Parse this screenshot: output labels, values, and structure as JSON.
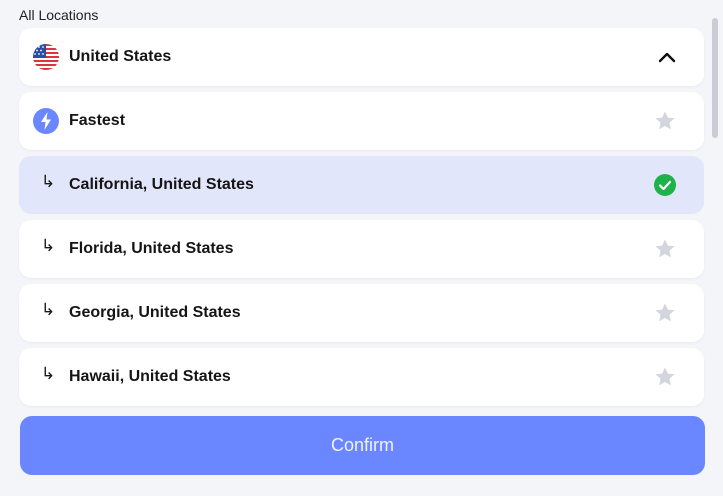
{
  "section": {
    "label": "All Locations"
  },
  "country": {
    "label": "United States",
    "flag_icon": "us-flag-icon",
    "toggle_icon": "chevron-up-icon",
    "expanded": true
  },
  "locations": [
    {
      "label": "Fastest",
      "lead_icon": "lightning-icon",
      "trail_icon": "star-icon",
      "selected": false,
      "favorite": false
    },
    {
      "label": "California, United States",
      "lead_icon": "sub-item-arrow-icon",
      "trail_icon": "check-circle-icon",
      "selected": true,
      "favorite": false
    },
    {
      "label": "Florida, United States",
      "lead_icon": "sub-item-arrow-icon",
      "trail_icon": "star-icon",
      "selected": false,
      "favorite": false
    },
    {
      "label": "Georgia, United States",
      "lead_icon": "sub-item-arrow-icon",
      "trail_icon": "star-icon",
      "selected": false,
      "favorite": false
    },
    {
      "label": "Hawaii, United States",
      "lead_icon": "sub-item-arrow-icon",
      "trail_icon": "star-icon",
      "selected": false,
      "favorite": false
    }
  ],
  "sub_item_glyph": "↳",
  "confirm": {
    "label": "Confirm"
  },
  "colors": {
    "accent": "#6b87ff",
    "selected_row": "#e2e6fa",
    "check_green": "#1fb24a",
    "star_inactive": "#d4d6de",
    "lightning_badge": "#6b87ff"
  }
}
